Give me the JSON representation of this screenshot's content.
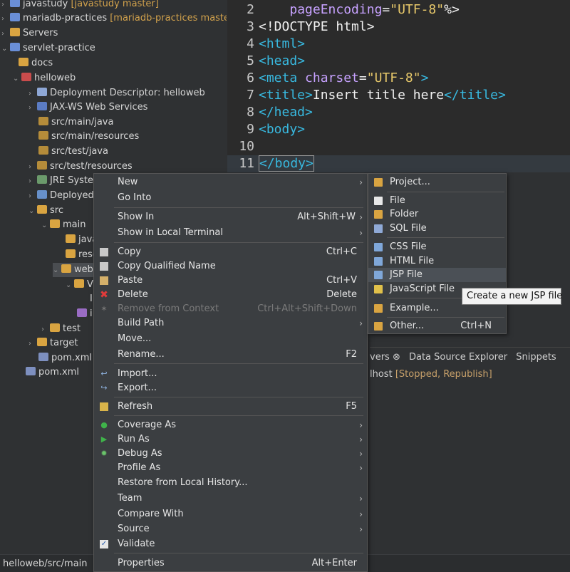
{
  "tree": {
    "items": [
      {
        "label": "javastudy",
        "git": "[javastudy master]"
      },
      {
        "label": "mariadb-practices",
        "git": "[mariadb-practices master]"
      },
      {
        "label": "Servers",
        "git": ""
      },
      {
        "label": "servlet-practice",
        "git": ""
      },
      {
        "label": "docs",
        "git": ""
      },
      {
        "label": "helloweb",
        "git": ""
      },
      {
        "label": "Deployment Descriptor: helloweb",
        "git": ""
      },
      {
        "label": "JAX-WS Web Services",
        "git": ""
      },
      {
        "label": "src/main/java",
        "git": ""
      },
      {
        "label": "src/main/resources",
        "git": ""
      },
      {
        "label": "src/test/java",
        "git": ""
      },
      {
        "label": "src/test/resources",
        "git": ""
      },
      {
        "label": "JRE System",
        "git": ""
      },
      {
        "label": "Deployed",
        "git": ""
      },
      {
        "label": "src",
        "git": ""
      },
      {
        "label": "main",
        "git": ""
      },
      {
        "label": "java",
        "git": ""
      },
      {
        "label": "reso",
        "git": ""
      },
      {
        "label": "web",
        "git": ""
      },
      {
        "label": "V",
        "git": ""
      },
      {
        "label": "I",
        "git": ""
      },
      {
        "label": "i",
        "git": ""
      },
      {
        "label": "test",
        "git": ""
      },
      {
        "label": "target",
        "git": ""
      },
      {
        "label": "pom.xml",
        "git": ""
      },
      {
        "label": "pom.xml",
        "git": ""
      }
    ]
  },
  "editor": {
    "lines": [
      {
        "num": "2",
        "indent": "    ",
        "attr": "pageEncoding",
        "eq": "=",
        "str": "\"UTF-8\"",
        "tail": "%>"
      },
      {
        "num": "3",
        "text": "<!DOCTYPE html>"
      },
      {
        "num": "4",
        "text": "<html>"
      },
      {
        "num": "5",
        "text": "<head>"
      },
      {
        "num": "6",
        "tag": "<meta ",
        "attr": "charset",
        "eq": "=",
        "str": "\"UTF-8\"",
        "tail": ">"
      },
      {
        "num": "7",
        "tag": "<title>",
        "text": "Insert title here",
        "tail": "</title>"
      },
      {
        "num": "8",
        "text": "</head>"
      },
      {
        "num": "9",
        "text": "<body>"
      },
      {
        "num": "10",
        "text": ""
      },
      {
        "num": "11",
        "text": "</body>"
      }
    ]
  },
  "bottom_panel": {
    "tabs": [
      "vers ⊗",
      "Data Source Explorer",
      "Snippets"
    ],
    "row_label": "lhost",
    "row_status": "[Stopped, Republish]"
  },
  "statusbar": {
    "path": "helloweb/src/main"
  },
  "context_menu": {
    "items": [
      {
        "label": "New",
        "accel": "",
        "submenu": true
      },
      {
        "label": "Go Into",
        "accel": ""
      },
      {
        "label": "Show In",
        "accel": "Alt+Shift+W",
        "submenu": true
      },
      {
        "label": "Show in Local Terminal",
        "accel": "",
        "submenu": true
      },
      {
        "label": "Copy",
        "accel": "Ctrl+C"
      },
      {
        "label": "Copy Qualified Name",
        "accel": ""
      },
      {
        "label": "Paste",
        "accel": "Ctrl+V"
      },
      {
        "label": "Delete",
        "accel": "Delete"
      },
      {
        "label": "Remove from Context",
        "accel": "Ctrl+Alt+Shift+Down",
        "disabled": true
      },
      {
        "label": "Build Path",
        "accel": "",
        "submenu": true
      },
      {
        "label": "Move...",
        "accel": ""
      },
      {
        "label": "Rename...",
        "accel": "F2"
      },
      {
        "label": "Import...",
        "accel": ""
      },
      {
        "label": "Export...",
        "accel": ""
      },
      {
        "label": "Refresh",
        "accel": "F5"
      },
      {
        "label": "Coverage As",
        "accel": "",
        "submenu": true
      },
      {
        "label": "Run As",
        "accel": "",
        "submenu": true
      },
      {
        "label": "Debug As",
        "accel": "",
        "submenu": true
      },
      {
        "label": "Profile As",
        "accel": "",
        "submenu": true
      },
      {
        "label": "Restore from Local History...",
        "accel": ""
      },
      {
        "label": "Team",
        "accel": "",
        "submenu": true
      },
      {
        "label": "Compare With",
        "accel": "",
        "submenu": true
      },
      {
        "label": "Source",
        "accel": "",
        "submenu": true
      },
      {
        "label": "Validate",
        "accel": ""
      },
      {
        "label": "Properties",
        "accel": "Alt+Enter"
      }
    ]
  },
  "submenu": {
    "items": [
      {
        "label": "Project...",
        "accel": ""
      },
      {
        "label": "File",
        "accel": ""
      },
      {
        "label": "Folder",
        "accel": ""
      },
      {
        "label": "SQL File",
        "accel": ""
      },
      {
        "label": "CSS File",
        "accel": ""
      },
      {
        "label": "HTML File",
        "accel": ""
      },
      {
        "label": "JSP File",
        "accel": ""
      },
      {
        "label": "JavaScript File",
        "accel": ""
      },
      {
        "label": "Example...",
        "accel": ""
      },
      {
        "label": "Other...",
        "accel": "Ctrl+N"
      }
    ]
  },
  "tooltip": {
    "text": "Create a new JSP file"
  },
  "colors": {
    "background": "#2f3133",
    "menu": "#3b3e41",
    "tag": "#38b9e0",
    "string": "#e7c86a",
    "attr": "#c7a2ff"
  }
}
